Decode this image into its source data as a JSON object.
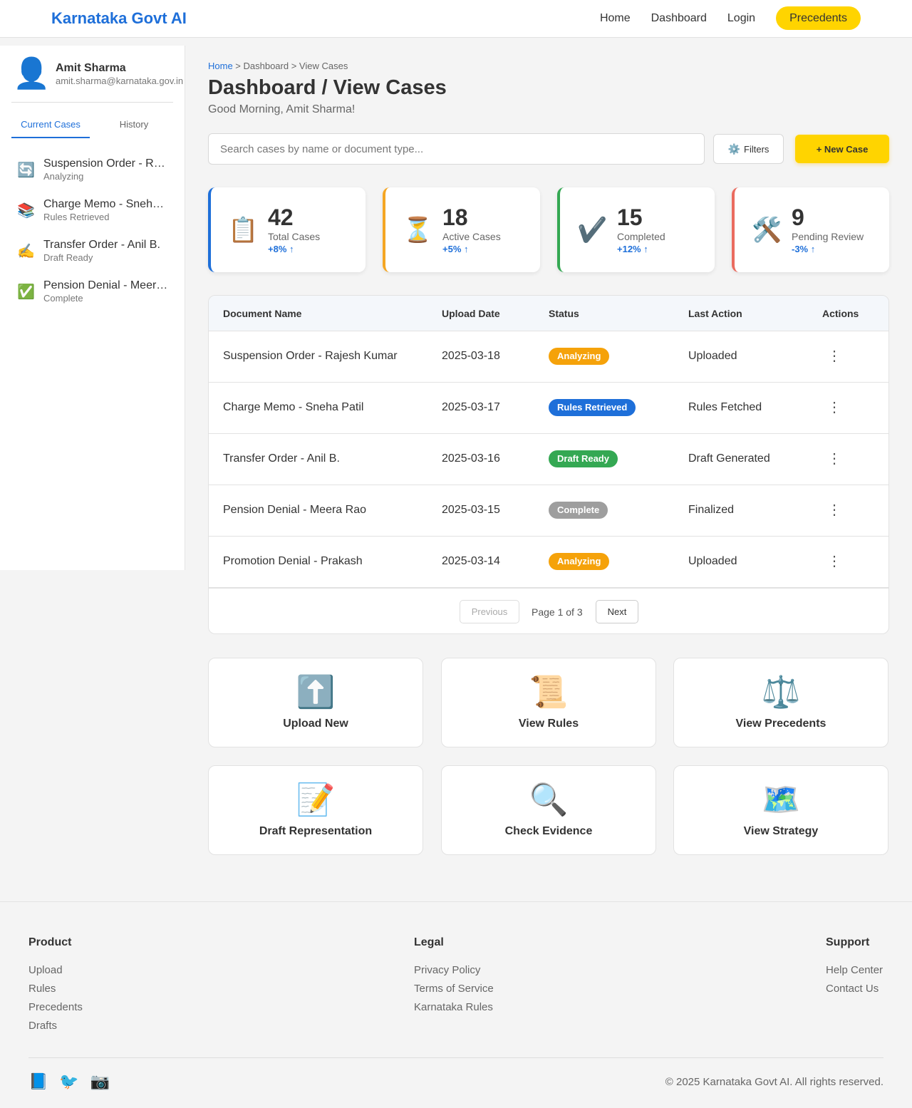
{
  "header": {
    "brand": "Karnataka Govt AI",
    "nav": [
      "Home",
      "Dashboard",
      "Login"
    ],
    "cta": "Precedents"
  },
  "sidebar": {
    "user_icon": "user-icon",
    "user_name": "Amit Sharma",
    "user_email": "amit.sharma@karnataka.gov.in",
    "tabs": [
      "Current Cases",
      "History"
    ],
    "active_tab": "Current Cases",
    "items": [
      {
        "icon": "🔄",
        "title": "Suspension Order - Rajesh Kumar",
        "status": "Analyzing"
      },
      {
        "icon": "📚",
        "title": "Charge Memo - Sneha Patil",
        "status": "Rules Retrieved"
      },
      {
        "icon": "✍️",
        "title": "Transfer Order - Anil B.",
        "status": "Draft Ready"
      },
      {
        "icon": "✅",
        "title": "Pension Denial - Meera Rao",
        "status": "Complete"
      }
    ]
  },
  "main": {
    "breadcrumb": {
      "home": "Home",
      "rest": " > Dashboard > View Cases"
    },
    "title": "Dashboard / View Cases",
    "greeting": "Good Morning, Amit Sharma!",
    "search_placeholder": "Search cases by name or document type...",
    "filters_label": "Filters",
    "filters_icon": "⚙️",
    "new_case_label": "+ New Case"
  },
  "stats": [
    {
      "icon": "📋",
      "value": "42",
      "label": "Total Cases",
      "trend": "+8% ↑",
      "color": "#1e6fd9"
    },
    {
      "icon": "⏳",
      "value": "18",
      "label": "Active Cases",
      "trend": "+5% ↑",
      "color": "#f5a623"
    },
    {
      "icon": "✔️",
      "value": "15",
      "label": "Completed",
      "trend": "+12% ↑",
      "color": "#34a853"
    },
    {
      "icon": "🛠️",
      "value": "9",
      "label": "Pending Review",
      "trend": "-3% ↑",
      "color": "#ea6b5f"
    }
  ],
  "table": {
    "headers": [
      "Document Name",
      "Upload Date",
      "Status",
      "Last Action",
      "Actions"
    ],
    "rows": [
      {
        "name": "Suspension Order - Rajesh Kumar",
        "date": "2025-03-18",
        "status": "Analyzing",
        "status_color": "#f5a20a",
        "last_action": "Uploaded",
        "action_icon": "⋮"
      },
      {
        "name": "Charge Memo - Sneha Patil",
        "date": "2025-03-17",
        "status": "Rules Retrieved",
        "status_color": "#1e6fd9",
        "last_action": "Rules Fetched",
        "action_icon": "⋮"
      },
      {
        "name": "Transfer Order - Anil B.",
        "date": "2025-03-16",
        "status": "Draft Ready",
        "status_color": "#34a853",
        "last_action": "Draft Generated",
        "action_icon": "⋮"
      },
      {
        "name": "Pension Denial - Meera Rao",
        "date": "2025-03-15",
        "status": "Complete",
        "status_color": "#9e9e9e",
        "last_action": "Finalized",
        "action_icon": "⋮"
      },
      {
        "name": "Promotion Denial - Prakash",
        "date": "2025-03-14",
        "status": "Analyzing",
        "status_color": "#f5a20a",
        "last_action": "Uploaded",
        "action_icon": "⋮"
      }
    ],
    "pager": {
      "prev": "Previous",
      "info": "Page 1 of 3",
      "next": "Next"
    }
  },
  "actions": [
    {
      "icon": "⬆️",
      "label": "Upload New"
    },
    {
      "icon": "📜",
      "label": "View Rules"
    },
    {
      "icon": "⚖️",
      "label": "View Precedents"
    },
    {
      "icon": "📝",
      "label": "Draft Representation"
    },
    {
      "icon": "🔍",
      "label": "Check Evidence"
    },
    {
      "icon": "🗺️",
      "label": "View Strategy"
    }
  ],
  "footer": {
    "columns": [
      {
        "title": "Product",
        "links": [
          "Upload",
          "Rules",
          "Precedents",
          "Drafts"
        ]
      },
      {
        "title": "Legal",
        "links": [
          "Privacy Policy",
          "Terms of Service",
          "Karnataka Rules"
        ]
      },
      {
        "title": "Support",
        "links": [
          "Help Center",
          "Contact Us"
        ]
      }
    ],
    "social_icons": [
      "📘",
      "🐦",
      "📷"
    ],
    "copyright": "© 2025 Karnataka Govt AI. All rights reserved."
  },
  "colors": {
    "accent": "#1e6fd9",
    "cta": "#ffd400"
  }
}
